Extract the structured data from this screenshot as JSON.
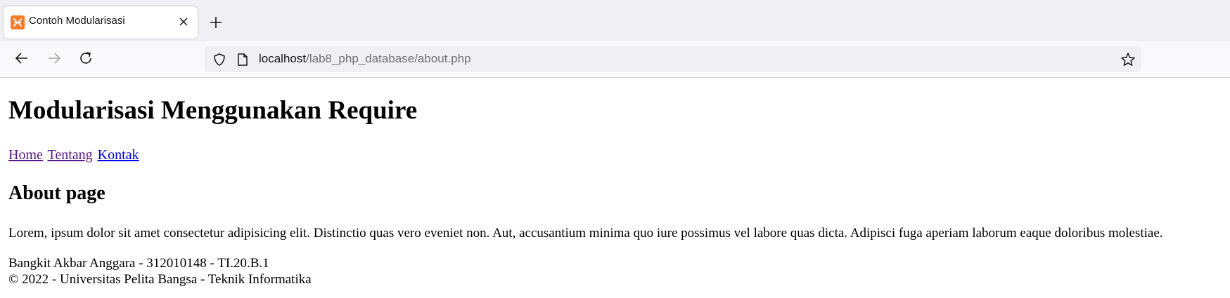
{
  "browser": {
    "tab": {
      "title": "Contoh Modularisasi",
      "favicon": "xampp-icon"
    },
    "url": {
      "host": "localhost",
      "path": "/lab8_php_database/about.php"
    }
  },
  "page": {
    "heading": "Modularisasi Menggunakan Require",
    "nav": [
      {
        "label": "Home",
        "visited": true
      },
      {
        "label": "Tentang",
        "visited": true
      },
      {
        "label": "Kontak",
        "visited": false
      }
    ],
    "section_title": "About page",
    "paragraph": "Lorem, ipsum dolor sit amet consectetur adipisicing elit. Distinctio quas vero eveniet non. Aut, accusantium minima quo iure possimus vel labore quas dicta. Adipisci fuga aperiam laborum eaque doloribus molestiae.",
    "footer": {
      "line1": "Bangkit Akbar Anggara - 312010148 - TI.20.B.1",
      "line2": "© 2022 - Universitas Pelita Bangsa - Teknik Informatika"
    }
  },
  "colors": {
    "favicon": "#fb7a24",
    "link_visited": "#551a8b",
    "link_unvisited": "#0000ee"
  }
}
